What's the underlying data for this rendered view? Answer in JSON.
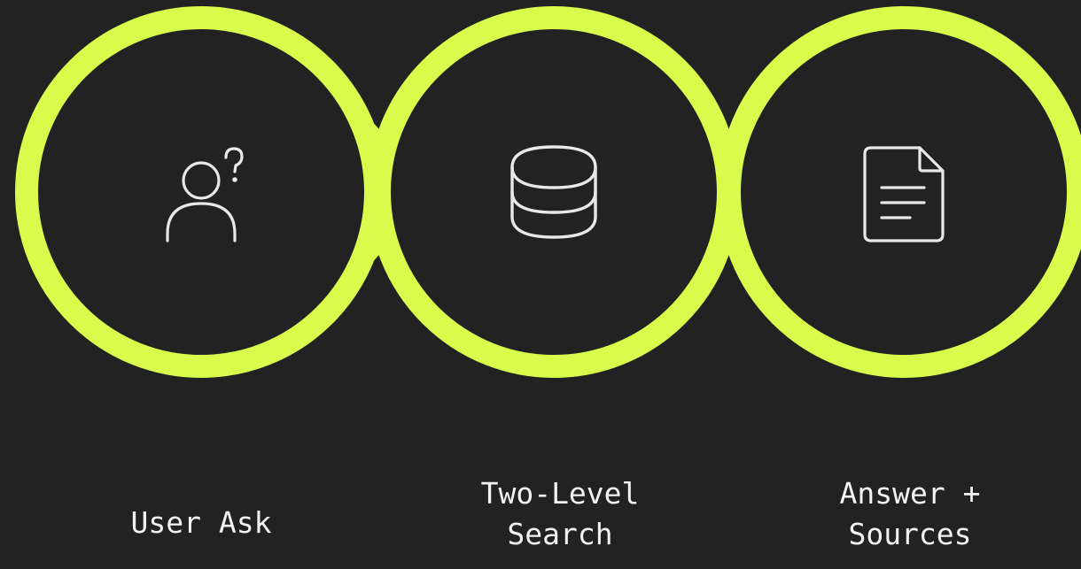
{
  "colors": {
    "background": "#222222",
    "ring": "#d8fb4c",
    "icon": "#e8e8e8",
    "text": "#f2f2f2"
  },
  "steps": [
    {
      "label": "User Ask",
      "icon": "user-question-icon"
    },
    {
      "label": "Two-Level\nSearch",
      "icon": "database-icon"
    },
    {
      "label": "Answer +\nSources",
      "icon": "document-icon"
    }
  ]
}
